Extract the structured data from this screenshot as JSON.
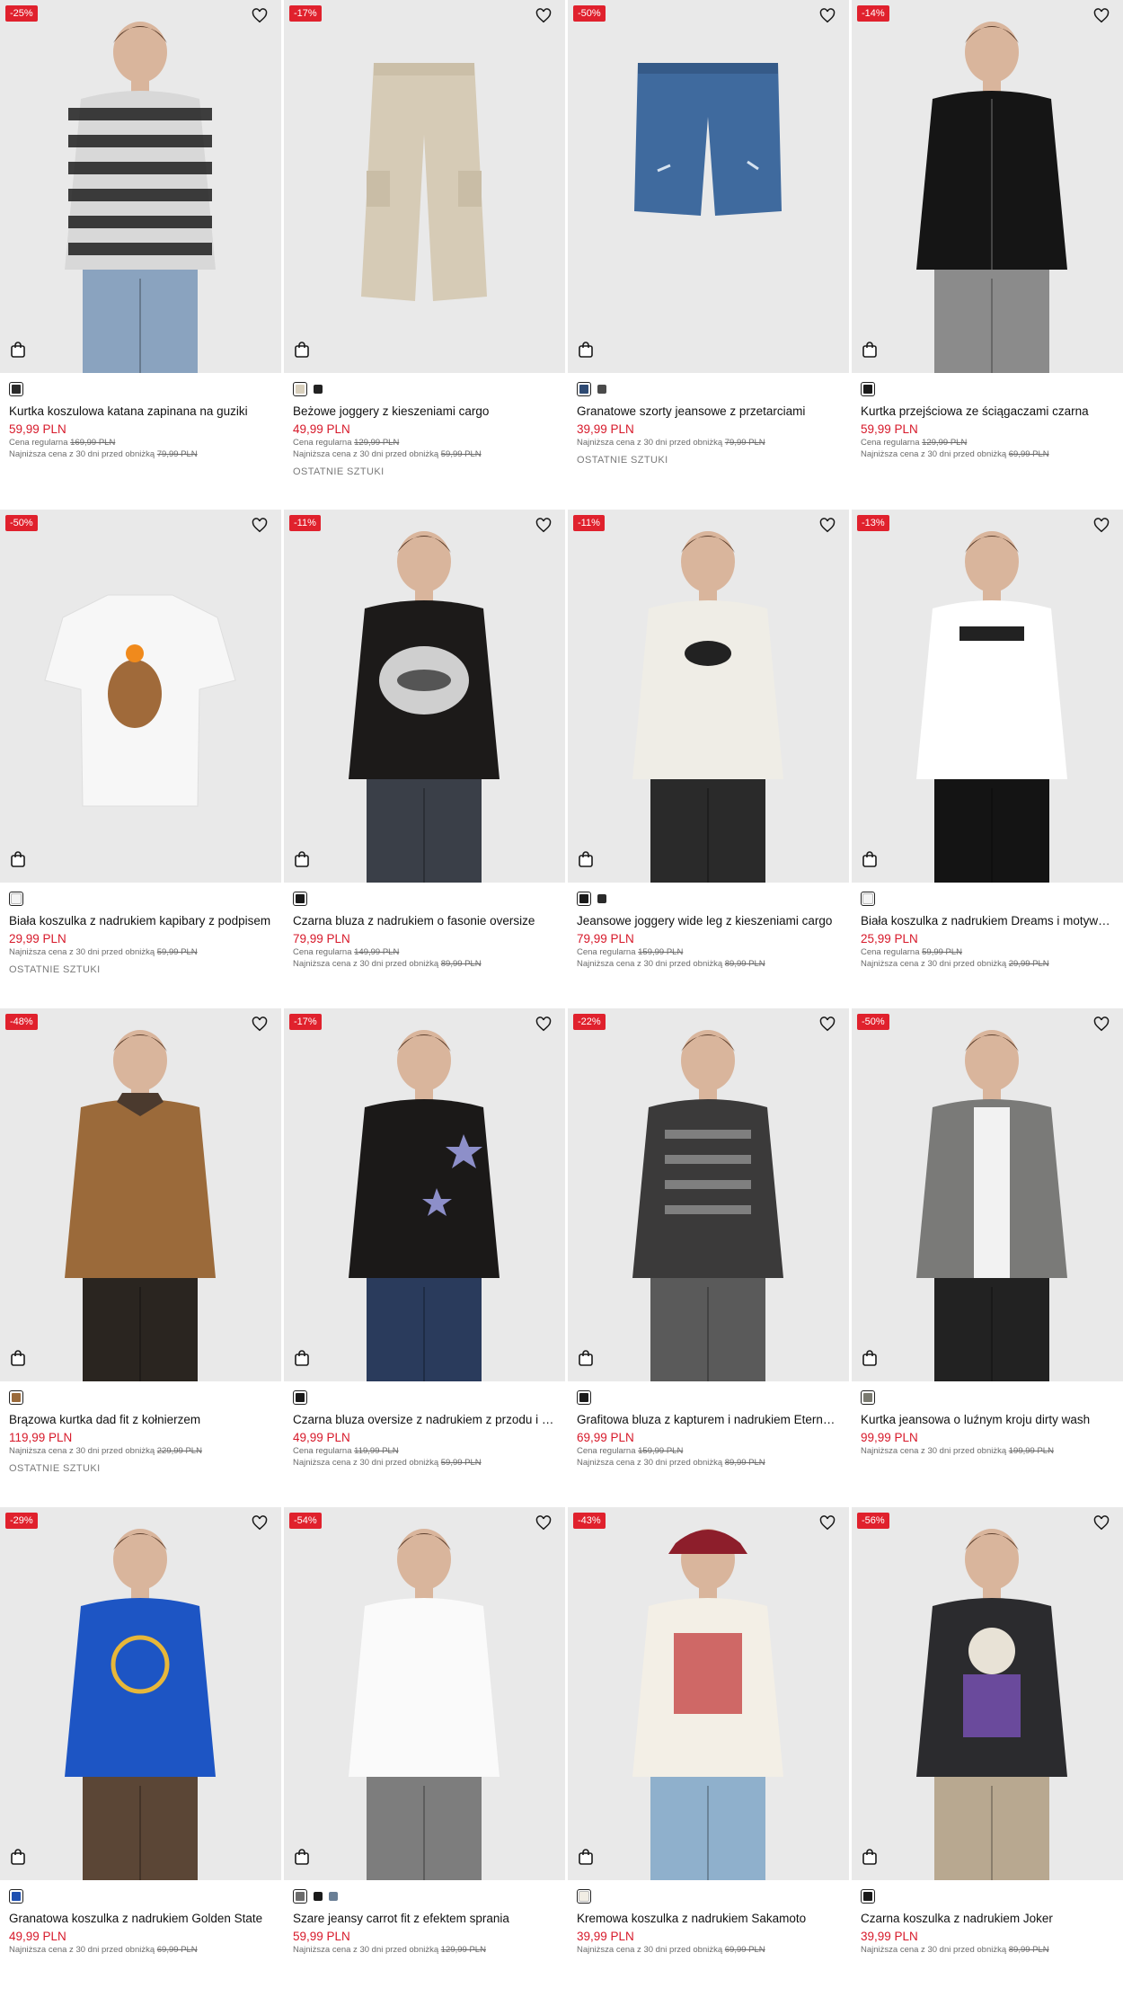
{
  "colors": {
    "sale": "#d7192a",
    "badge": "#e0212d",
    "photo_bg": "#e9e9e9"
  },
  "icons": {
    "wishlist": "heart-icon",
    "add_to_cart": "shopping-bag-icon"
  },
  "products": [
    {
      "discount": "-25%",
      "name": "Kurtka koszulowa katana zapinana na guziki",
      "price": "59,99 PLN",
      "regular_label": "Cena regularna",
      "regular_price": "169,99 PLN",
      "lowest_label": "Najniższa cena z 30 dni przed obniżką",
      "lowest_price": "79,99 PLN",
      "note": "",
      "swatches": [
        "#2b2b2b"
      ],
      "garment": "plaid-shirt"
    },
    {
      "discount": "-17%",
      "name": "Beżowe joggery z kieszeniami cargo",
      "price": "49,99 PLN",
      "regular_label": "Cena regularna",
      "regular_price": "129,99 PLN",
      "lowest_label": "Najniższa cena z 30 dni przed obniżką",
      "lowest_price": "59,99 PLN",
      "note": "OSTATNIE SZTUKI",
      "swatches": [
        "#d8cfbc",
        "#222222"
      ],
      "garment": "beige-pants"
    },
    {
      "discount": "-50%",
      "name": "Granatowe szorty jeansowe z przetarciami",
      "price": "39,99 PLN",
      "regular_label": "",
      "regular_price": "",
      "lowest_label": "Najniższa cena z 30 dni przed obniżką",
      "lowest_price": "79,99 PLN",
      "note": "OSTATNIE SZTUKI",
      "swatches": [
        "#2e4a73",
        "#4a4a4a"
      ],
      "garment": "denim-shorts"
    },
    {
      "discount": "-14%",
      "name": "Kurtka przejściowa ze ściągaczami czarna",
      "price": "59,99 PLN",
      "regular_label": "Cena regularna",
      "regular_price": "129,99 PLN",
      "lowest_label": "Najniższa cena z 30 dni przed obniżką",
      "lowest_price": "69,99 PLN",
      "note": "",
      "swatches": [
        "#1a1a1a"
      ],
      "garment": "black-jacket"
    },
    {
      "discount": "-50%",
      "name": "Biała koszulka z nadrukiem kapibary z podpisem",
      "price": "29,99 PLN",
      "regular_label": "",
      "regular_price": "",
      "lowest_label": "Najniższa cena z 30 dni przed obniżką",
      "lowest_price": "59,99 PLN",
      "note": "OSTATNIE SZTUKI",
      "swatches": [
        "#f4f4f4"
      ],
      "garment": "white-tee-capybara"
    },
    {
      "discount": "-11%",
      "name": "Czarna bluza z nadrukiem o fasonie oversize",
      "price": "79,99 PLN",
      "regular_label": "Cena regularna",
      "regular_price": "149,99 PLN",
      "lowest_label": "Najniższa cena z 30 dni przed obniżką",
      "lowest_price": "89,99 PLN",
      "note": "",
      "swatches": [
        "#1a1a1a"
      ],
      "garment": "black-hoodie-lips"
    },
    {
      "discount": "-11%",
      "name": "Jeansowe joggery wide leg z kieszeniami cargo",
      "price": "79,99 PLN",
      "regular_label": "Cena regularna",
      "regular_price": "159,99 PLN",
      "lowest_label": "Najniższa cena z 30 dni przed obniżką",
      "lowest_price": "89,99 PLN",
      "note": "",
      "swatches": [
        "#1a1a1a",
        "#2a2a2a"
      ],
      "garment": "black-cargo-outfit"
    },
    {
      "discount": "-13%",
      "name": "Biała koszulka z nadrukiem Dreams i motywem",
      "price": "25,99 PLN",
      "regular_label": "Cena regularna",
      "regular_price": "59,99 PLN",
      "lowest_label": "Najniższa cena z 30 dni przed obniżką",
      "lowest_price": "29,99 PLN",
      "note": "",
      "swatches": [
        "#f4f4f4"
      ],
      "garment": "white-tee-dreams"
    },
    {
      "discount": "-48%",
      "name": "Brązowa kurtka dad fit z kołnierzem",
      "price": "119,99 PLN",
      "regular_label": "",
      "regular_price": "",
      "lowest_label": "Najniższa cena z 30 dni przed obniżką",
      "lowest_price": "229,99 PLN",
      "note": "OSTATNIE SZTUKI",
      "swatches": [
        "#9a6a3b"
      ],
      "garment": "brown-jacket"
    },
    {
      "discount": "-17%",
      "name": "Czarna bluza oversize z nadrukiem z przodu i z tyłu",
      "price": "49,99 PLN",
      "regular_label": "Cena regularna",
      "regular_price": "119,99 PLN",
      "lowest_label": "Najniższa cena z 30 dni przed obniżką",
      "lowest_price": "59,99 PLN",
      "note": "",
      "swatches": [
        "#1a1a1a"
      ],
      "garment": "black-sweatshirt-stars"
    },
    {
      "discount": "-22%",
      "name": "Grafitowa bluza z kapturem i nadrukiem Eternal Darkness",
      "price": "69,99 PLN",
      "regular_label": "Cena regularna",
      "regular_price": "159,99 PLN",
      "lowest_label": "Najniższa cena z 30 dni przed obniżką",
      "lowest_price": "89,99 PLN",
      "note": "",
      "swatches": [
        "#1a1a1a"
      ],
      "garment": "graphite-hoodie"
    },
    {
      "discount": "-50%",
      "name": "Kurtka jeansowa o luźnym kroju dirty wash",
      "price": "99,99 PLN",
      "regular_label": "",
      "regular_price": "",
      "lowest_label": "Najniższa cena z 30 dni przed obniżką",
      "lowest_price": "199,99 PLN",
      "note": "",
      "swatches": [
        "#7a7a70"
      ],
      "garment": "grey-denim-jacket"
    },
    {
      "discount": "-29%",
      "name": "Granatowa koszulka z nadrukiem Golden State",
      "price": "49,99 PLN",
      "regular_label": "",
      "regular_price": "",
      "lowest_label": "Najniższa cena z 30 dni przed obniżką",
      "lowest_price": "69,99 PLN",
      "note": "",
      "swatches": [
        "#1e4fb0"
      ],
      "garment": "blue-tee"
    },
    {
      "discount": "-54%",
      "name": "Szare jeansy carrot fit z efektem sprania",
      "price": "59,99 PLN",
      "regular_label": "",
      "regular_price": "",
      "lowest_label": "Najniższa cena z 30 dni przed obniżką",
      "lowest_price": "129,99 PLN",
      "note": "",
      "swatches": [
        "#6b6b6b",
        "#1a1a1a",
        "#6a7f96"
      ],
      "garment": "grey-jeans"
    },
    {
      "discount": "-43%",
      "name": "Kremowa koszulka z nadrukiem Sakamoto",
      "price": "39,99 PLN",
      "regular_label": "",
      "regular_price": "",
      "lowest_label": "Najniższa cena z 30 dni przed obniżką",
      "lowest_price": "69,99 PLN",
      "note": "",
      "swatches": [
        "#f1ede4"
      ],
      "garment": "cream-tee"
    },
    {
      "discount": "-56%",
      "name": "Czarna koszulka z nadrukiem Joker",
      "price": "39,99 PLN",
      "regular_label": "",
      "regular_price": "",
      "lowest_label": "Najniższa cena z 30 dni przed obniżką",
      "lowest_price": "89,99 PLN",
      "note": "",
      "swatches": [
        "#1a1a1a"
      ],
      "garment": "joker-tee"
    }
  ]
}
